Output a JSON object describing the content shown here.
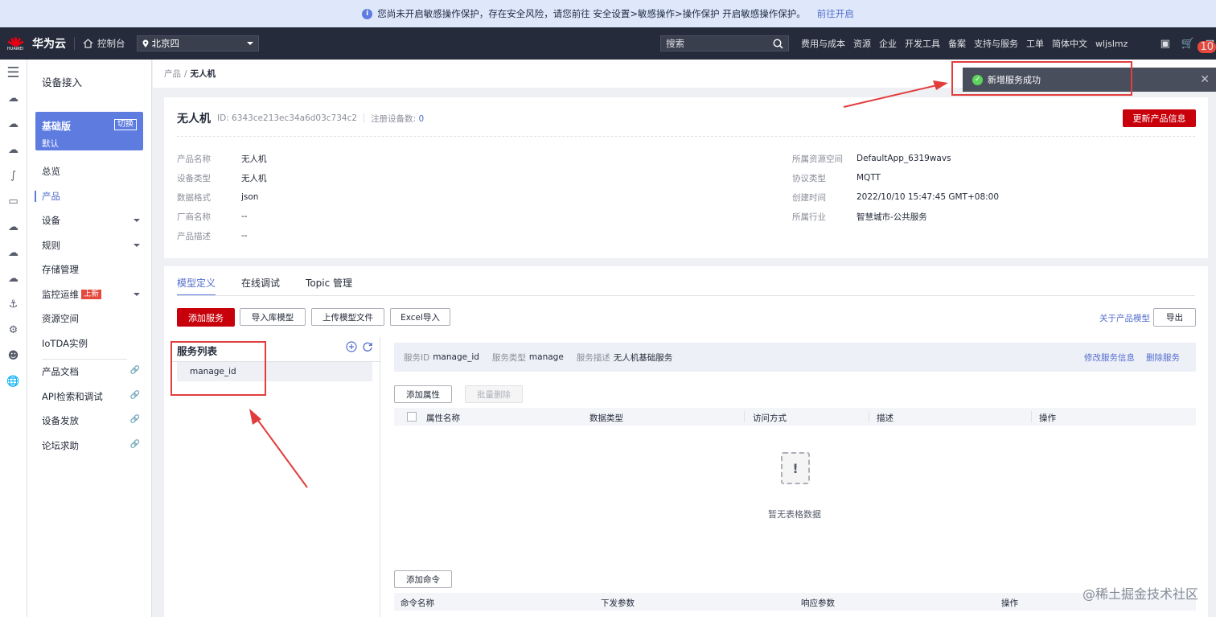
{
  "banner": {
    "text": "您尚未开启敏感操作保护，存在安全风险，请您前往 安全设置>敏感操作>操作保护 开启敏感操作保护。",
    "link": "前往开启"
  },
  "topbar": {
    "logo_text": "HUAWEI",
    "brand": "华为云",
    "console": "控制台",
    "region": "北京四",
    "search_placeholder": "搜索",
    "nav": [
      "费用与成本",
      "资源",
      "企业",
      "开发工具",
      "备案",
      "支持与服务",
      "工单",
      "简体中文",
      "wljslmz"
    ],
    "badge": "10"
  },
  "sidenav": {
    "title": "设备接入",
    "edition": {
      "name": "基础版",
      "sub": "默认",
      "switch": "切换"
    },
    "items": [
      {
        "label": "总览"
      },
      {
        "label": "产品"
      },
      {
        "label": "设备"
      },
      {
        "label": "规则"
      },
      {
        "label": "存储管理"
      },
      {
        "label": "监控运维",
        "tag": "上新"
      },
      {
        "label": "资源空间"
      },
      {
        "label": "IoTDA实例"
      },
      {
        "label": "产品文档"
      },
      {
        "label": "API检索和调试"
      },
      {
        "label": "设备发放"
      },
      {
        "label": "论坛求助"
      }
    ]
  },
  "breadcrumb": {
    "parent": "产品",
    "sep": "/",
    "current": "无人机"
  },
  "product": {
    "name": "无人机",
    "id": "ID: 6343ce213ec34a6d03c734c2",
    "device_label": "注册设备数:",
    "device_count": "0",
    "update_button": "更新产品信息",
    "left": [
      {
        "k": "产品名称",
        "v": "无人机"
      },
      {
        "k": "设备类型",
        "v": "无人机"
      },
      {
        "k": "数据格式",
        "v": "json"
      },
      {
        "k": "厂商名称",
        "v": "--"
      },
      {
        "k": "产品描述",
        "v": "--"
      }
    ],
    "right": [
      {
        "k": "所属资源空间",
        "v": "DefaultApp_6319wavs"
      },
      {
        "k": "协议类型",
        "v": "MQTT"
      },
      {
        "k": "创建时间",
        "v": "2022/10/10 15:47:45 GMT+08:00"
      },
      {
        "k": "所属行业",
        "v": "智慧城市-公共服务"
      }
    ]
  },
  "tabs": [
    "模型定义",
    "在线调试",
    "Topic 管理"
  ],
  "toolbar": {
    "add_service": "添加服务",
    "import_lib": "导入库模型",
    "upload_model": "上传模型文件",
    "excel_import": "Excel导入",
    "about_model": "关于产品模型",
    "export": "导出"
  },
  "services": {
    "title": "服务列表",
    "items": [
      "manage_id"
    ]
  },
  "service_info": {
    "id_label": "服务ID",
    "id": "manage_id",
    "type_label": "服务类型",
    "type": "manage",
    "desc_label": "服务描述",
    "desc": "无人机基础服务",
    "edit": "修改服务信息",
    "delete": "删除服务"
  },
  "props": {
    "add": "添加属性",
    "batch_delete": "批量删除",
    "columns": [
      "属性名称",
      "数据类型",
      "访问方式",
      "描述",
      "操作"
    ],
    "empty": "暂无表格数据"
  },
  "commands": {
    "add": "添加命令",
    "columns": [
      "命令名称",
      "下发参数",
      "响应参数",
      "操作"
    ]
  },
  "toast": {
    "text": "新增服务成功"
  },
  "watermark": "@稀土掘金技术社区",
  "colors": {
    "accent": "#5e7ce0",
    "primary_red": "#c7000b",
    "annotation_red": "#e23d3d",
    "topbar": "#252b3a"
  }
}
